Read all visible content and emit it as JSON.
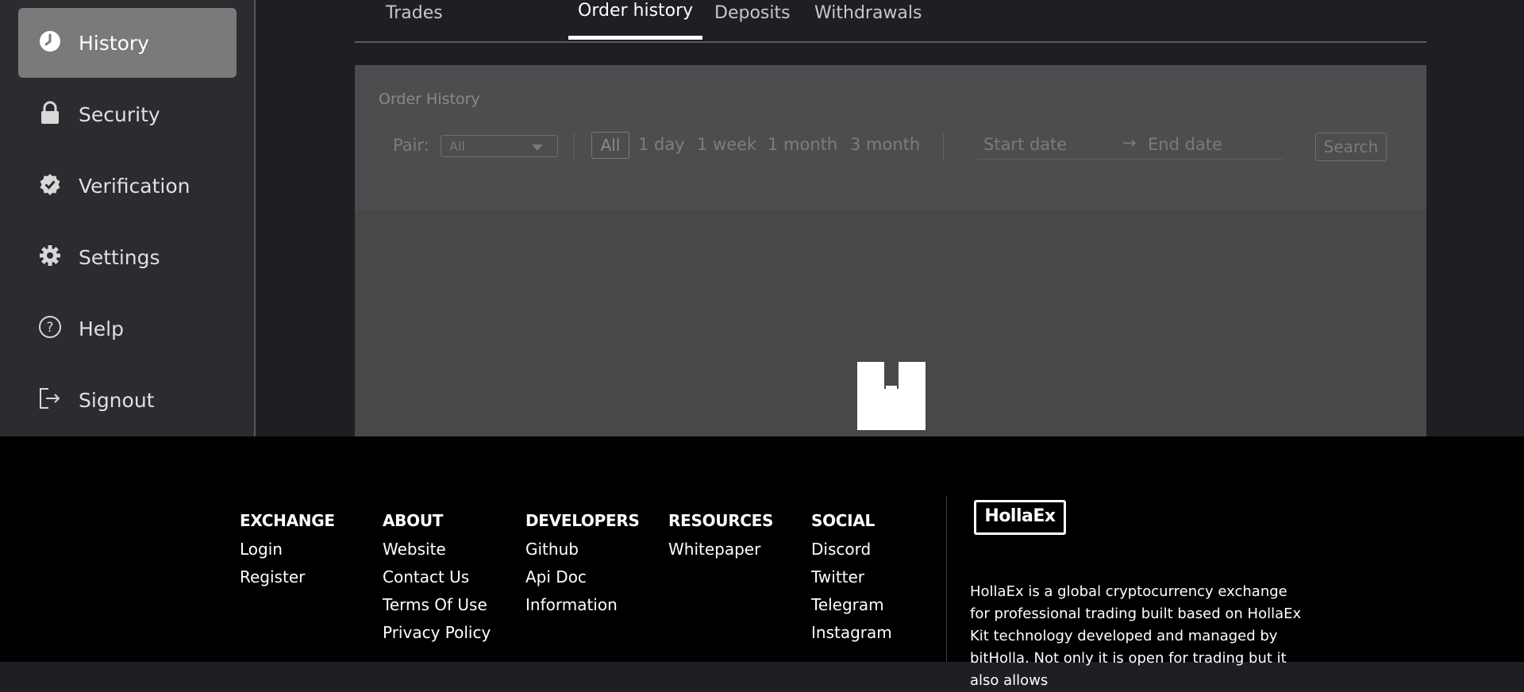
{
  "sidebar": {
    "items": [
      {
        "label": "History",
        "icon": "clock-icon",
        "active": true
      },
      {
        "label": "Security",
        "icon": "lock-icon"
      },
      {
        "label": "Verification",
        "icon": "verified-check-icon"
      },
      {
        "label": "Settings",
        "icon": "gear-icon"
      },
      {
        "label": "Help",
        "icon": "help-circle-icon"
      },
      {
        "label": "Signout",
        "icon": "signout-icon"
      }
    ]
  },
  "tabs": [
    {
      "label": "Trades"
    },
    {
      "label": "Order history",
      "active": true
    },
    {
      "label": "Deposits"
    },
    {
      "label": "Withdrawals"
    }
  ],
  "panel": {
    "title": "Order History",
    "pair_label": "Pair:",
    "pair_value": "All",
    "ranges": [
      "All",
      "1 day",
      "1 week",
      "1 month",
      "3 month"
    ],
    "start_placeholder": "Start date",
    "end_placeholder": "End date",
    "search_label": "Search",
    "date_arrow": "→"
  },
  "footer": {
    "columns": [
      {
        "head": "EXCHANGE",
        "links": [
          "Login",
          "Register"
        ]
      },
      {
        "head": "ABOUT",
        "links": [
          "Website",
          "Contact Us",
          "Terms Of Use",
          "Privacy Policy"
        ]
      },
      {
        "head": "DEVELOPERS",
        "links": [
          "Github",
          "Api Doc",
          "Information"
        ]
      },
      {
        "head": "RESOURCES",
        "links": [
          "Whitepaper"
        ]
      },
      {
        "head": "SOCIAL",
        "links": [
          "Discord",
          "Twitter",
          "Telegram",
          "Instagram"
        ]
      }
    ],
    "logo_text": "HollaEx",
    "description": "HollaEx is a global cryptocurrency exchange for professional trading built based on HollaEx Kit technology developed and managed by bitHolla. Not only it is open for trading but it also allows"
  },
  "colors": {
    "sidebar_bg": "#2b2b30",
    "active_item_bg": "#7a7a7a",
    "main_bg": "#1e1e23",
    "panel_bg": "#484849",
    "footer_bg": "#000000"
  }
}
